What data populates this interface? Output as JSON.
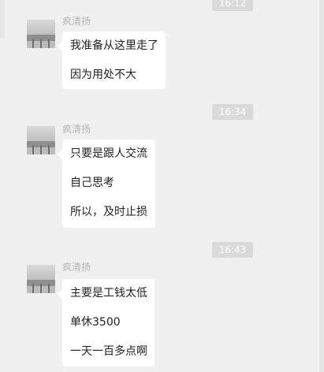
{
  "time_chips": [
    "16:12",
    "16:34",
    "16:43"
  ],
  "messages": [
    {
      "sender": "疯清扬",
      "lines": [
        "我准备从这里走了",
        "因为用处不大"
      ]
    },
    {
      "sender": "疯清扬",
      "lines": [
        "只要是跟人交流",
        "自己思考",
        "所以，及时止损"
      ]
    },
    {
      "sender": "疯清扬",
      "lines": [
        "主要是工钱太低",
        "单休3500",
        "一天一百多点啊"
      ]
    }
  ]
}
